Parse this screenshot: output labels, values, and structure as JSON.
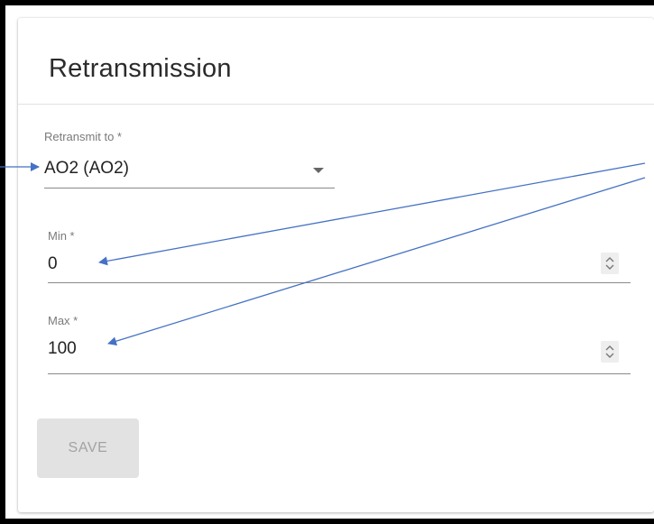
{
  "card": {
    "title": "Retransmission"
  },
  "form": {
    "retransmit_to": {
      "label": "Retransmit to *",
      "value": "AO2 (AO2)"
    },
    "min": {
      "label": "Min *",
      "value": "0"
    },
    "max": {
      "label": "Max *",
      "value": "100"
    },
    "save_label": "SAVE"
  },
  "icons": {
    "dropdown": "chevron-down-icon",
    "spinner": "number-spinner-icon"
  },
  "colors": {
    "annotation_arrow": "#4472C4",
    "disabled_button_bg": "#e2e2e2",
    "disabled_button_text": "#a3a3a3"
  }
}
